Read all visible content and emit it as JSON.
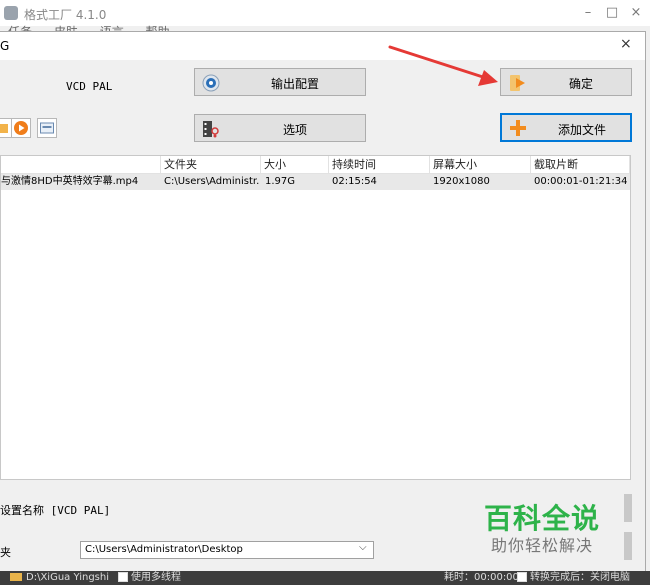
{
  "window": {
    "title": "格式工厂 4.1.0",
    "menu": [
      "任务",
      "皮肤",
      "语言",
      "帮助"
    ],
    "minimize": "–",
    "maximize": "□",
    "close": "×"
  },
  "dialog": {
    "title": "G",
    "close": "×",
    "preset_label": "VCD PAL",
    "output_config_label": "输出配置",
    "ok_label": "确定",
    "options_label": "选项",
    "add_file_label": "添加文件"
  },
  "table": {
    "columns": [
      "",
      "文件夹",
      "大小",
      "持续时间",
      "屏幕大小",
      "截取片断"
    ],
    "rows": [
      {
        "name": "与激情8HD中英特效字幕.mp4",
        "folder": "C:\\Users\\Administr...",
        "size": "1.97G",
        "duration": "02:15:54",
        "screen": "1920x1080",
        "clip": "00:00:01-01:21:34"
      }
    ]
  },
  "bottom": {
    "preset_name": "设置名称 [VCD PAL]",
    "folder_label": "夹",
    "folder_value": "C:\\Users\\Administrator\\Desktop",
    "folder_chevron": "⌵"
  },
  "watermark": {
    "main": "百科全说",
    "sub": "助你轻松解决"
  },
  "statusbar": {
    "path": "D:\\XiGua Yingshi",
    "multithread": "使用多线程",
    "elapsed": "耗时：00:00:00",
    "after_convert": "转换完成后：关闭电脑"
  },
  "colors": {
    "accent": "#0078d7",
    "annotation": "#e53935",
    "watermark": "#2eb34a"
  }
}
